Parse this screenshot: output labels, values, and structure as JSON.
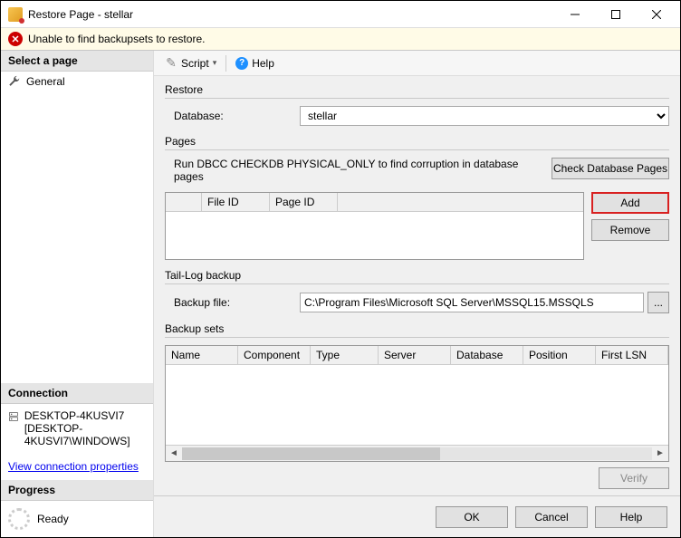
{
  "title": "Restore Page - stellar",
  "banner": {
    "message": "Unable to find backupsets to restore."
  },
  "sidebar": {
    "selectPage": "Select a page",
    "pages": [
      {
        "label": "General"
      }
    ],
    "connectionHeader": "Connection",
    "server": "DESKTOP-4KUSVI7",
    "serverDetail": "[DESKTOP-4KUSVI7\\WINDOWS]",
    "link": "View connection properties",
    "progressHeader": "Progress",
    "progressText": "Ready"
  },
  "toolbar": {
    "script": "Script",
    "help": "Help"
  },
  "restore": {
    "title": "Restore",
    "dbLabel": "Database:",
    "dbValue": "stellar"
  },
  "pages": {
    "title": "Pages",
    "hint": "Run DBCC CHECKDB PHYSICAL_ONLY to find corruption in database pages",
    "checkBtn": "Check Database Pages",
    "cols": {
      "fileId": "File ID",
      "pageId": "Page ID"
    },
    "addBtn": "Add",
    "removeBtn": "Remove"
  },
  "taillog": {
    "title": "Tail-Log backup",
    "label": "Backup file:",
    "value": "C:\\Program Files\\Microsoft SQL Server\\MSSQL15.MSSQLS",
    "browse": "..."
  },
  "sets": {
    "title": "Backup sets",
    "cols": {
      "name": "Name",
      "component": "Component",
      "type": "Type",
      "server": "Server",
      "database": "Database",
      "position": "Position",
      "firstlsn": "First LSN"
    },
    "verifyBtn": "Verify"
  },
  "footer": {
    "ok": "OK",
    "cancel": "Cancel",
    "help": "Help"
  }
}
